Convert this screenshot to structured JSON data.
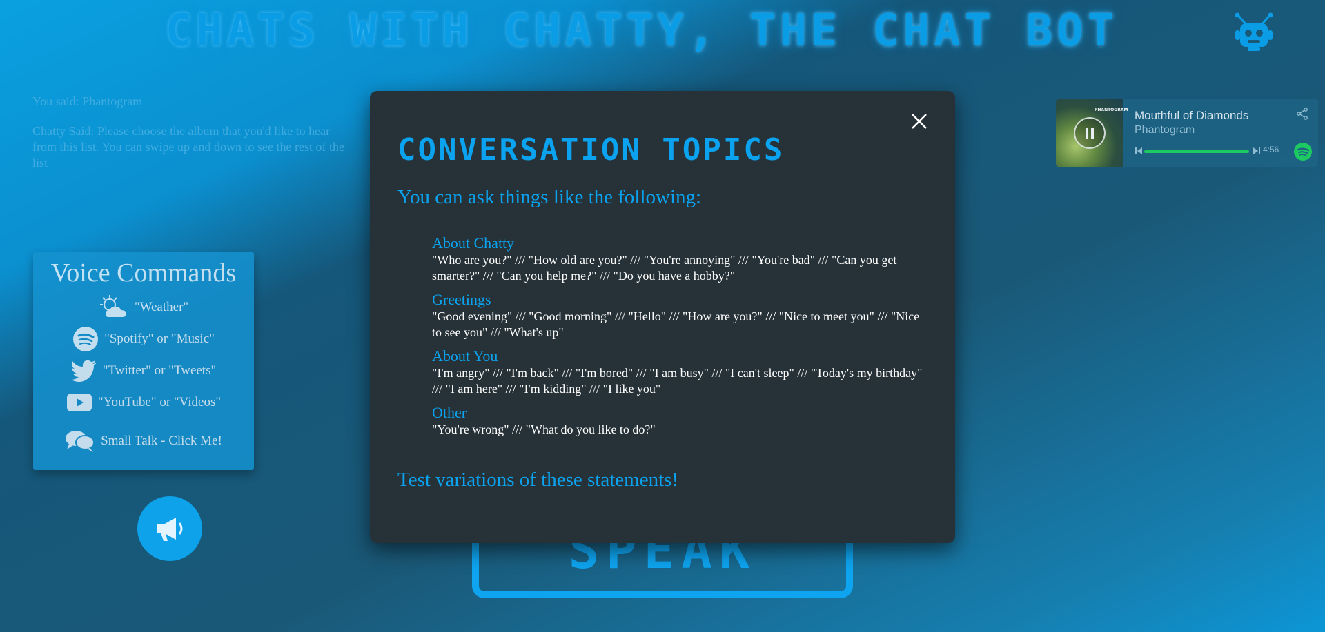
{
  "header": {
    "title": "CHATS WITH CHATTY, THE CHAT BOT",
    "icon": "robot-icon"
  },
  "transcript": {
    "user_line": "You said: Phantogram",
    "bot_line": "Chatty Said: Please choose the album that you'd like to hear from this list. You can swipe up and down to see the rest of the list"
  },
  "voice_commands": {
    "title": "Voice Commands",
    "items": [
      {
        "icon": "weather-icon",
        "label": "\"Weather\""
      },
      {
        "icon": "spotify-icon",
        "label": "\"Spotify\" or \"Music\""
      },
      {
        "icon": "twitter-icon",
        "label": "\"Twitter\" or \"Tweets\""
      },
      {
        "icon": "youtube-icon",
        "label": "\"YouTube\" or \"Videos\""
      },
      {
        "icon": "chat-bubbles-icon",
        "label": "Small Talk - Click Me!"
      }
    ]
  },
  "megaphone": {
    "icon": "megaphone-icon"
  },
  "speak_button": {
    "label": "SPEAK"
  },
  "player": {
    "track": "Mouthful of Diamonds",
    "artist": "Phantogram",
    "album_text": "PHANTOGRAM",
    "time": "4:56",
    "progress": 1.0,
    "colors": {
      "progress": "#1ed760"
    }
  },
  "modal": {
    "title": "CONVERSATION TOPICS",
    "intro": "You can ask things like the following:",
    "topics": [
      {
        "title": "About Chatty",
        "text": "\"Who are you?\" /// \"How old are you?\" /// \"You're annoying\" /// \"You're bad\" /// \"Can you get smarter?\" /// \"Can you help me?\" /// \"Do you have a hobby?\""
      },
      {
        "title": "Greetings",
        "text": "\"Good evening\" /// \"Good morning\" /// \"Hello\" /// \"How are you?\" /// \"Nice to meet you\" /// \"Nice to see you\" /// \"What's up\""
      },
      {
        "title": "About You",
        "text": "\"I'm angry\" /// \"I'm back\" /// \"I'm bored\" /// \"I am busy\" /// \"I can't sleep\" /// \"Today's my birthday\" /// \"I am here\" /// \"I'm kidding\" /// \"I like you\""
      },
      {
        "title": "Other",
        "text": "\"You're wrong\" /// \"What do you like to do?\""
      }
    ],
    "footer": "Test variations of these statements!"
  },
  "colors": {
    "accent": "#0ba3ef",
    "modal_bg": "#263238",
    "panel_bg": "#1592d0"
  }
}
